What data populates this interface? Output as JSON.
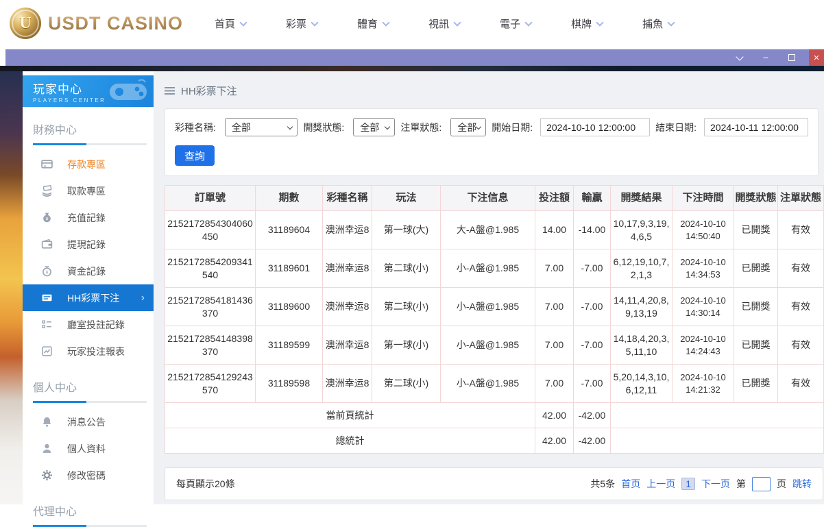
{
  "topnav": {
    "logo": {
      "letter": "U",
      "text": "USDT CASINO"
    },
    "items": [
      {
        "label": "首頁"
      },
      {
        "label": "彩票"
      },
      {
        "label": "體育"
      },
      {
        "label": "視訊"
      },
      {
        "label": "電子"
      },
      {
        "label": "棋牌"
      },
      {
        "label": "捕魚"
      }
    ]
  },
  "sidebar": {
    "title": "玩家中心",
    "subtitle": "PLAYERS CENTER",
    "sections": [
      {
        "title": "財務中心",
        "items": [
          {
            "label": "存款專區",
            "icon": "deposit-card-icon",
            "highlight": "orange"
          },
          {
            "label": "取款專區",
            "icon": "withdraw-hand-icon"
          },
          {
            "label": "充值記錄",
            "icon": "money-bag-icon"
          },
          {
            "label": "提現記錄",
            "icon": "wallet-icon"
          },
          {
            "label": "資金記錄",
            "icon": "coin-purse-icon"
          },
          {
            "label": "HH彩票下注",
            "icon": "bet-card-icon",
            "active": true
          },
          {
            "label": "廳室投註記錄",
            "icon": "list-icon"
          },
          {
            "label": "玩家投注報表",
            "icon": "report-chart-icon"
          }
        ]
      },
      {
        "title": "個人中心",
        "items": [
          {
            "label": "消息公告",
            "icon": "bell-icon"
          },
          {
            "label": "個人資料",
            "icon": "person-icon"
          },
          {
            "label": "修改密碼",
            "icon": "gear-icon"
          }
        ]
      },
      {
        "title": "代理中心",
        "items": []
      }
    ]
  },
  "main": {
    "page_title": "HH彩票下注",
    "filters": {
      "lottery_label": "彩種名稱:",
      "lottery_value": "全部",
      "draw_status_label": "開獎狀態:",
      "draw_status_value": "全部",
      "order_status_label": "注單狀態:",
      "order_status_value": "全部",
      "start_label": "開始日期:",
      "start_value": "2024-10-10 12:00:00",
      "end_label": "結束日期:",
      "end_value": "2024-10-11 12:00:00",
      "search_button": "查詢"
    },
    "table": {
      "headers": [
        "訂單號",
        "期數",
        "彩種名稱",
        "玩法",
        "下注信息",
        "投注額",
        "輸贏",
        "開獎結果",
        "下注時間",
        "開獎狀態",
        "注單狀態"
      ],
      "rows": [
        [
          "2152172854304060450",
          "31189604",
          "澳洲幸运8",
          "第一球(大)",
          "大-A盤@1.985",
          "14.00",
          "-14.00",
          "10,17,9,3,19,4,6,5",
          "2024-10-10 14:50:40",
          "已開獎",
          "有效"
        ],
        [
          "2152172854209341540",
          "31189601",
          "澳洲幸运8",
          "第二球(小)",
          "小-A盤@1.985",
          "7.00",
          "-7.00",
          "6,12,19,10,7,2,1,3",
          "2024-10-10 14:34:53",
          "已開獎",
          "有效"
        ],
        [
          "2152172854181436370",
          "31189600",
          "澳洲幸运8",
          "第二球(小)",
          "小-A盤@1.985",
          "7.00",
          "-7.00",
          "14,11,4,20,8,9,13,19",
          "2024-10-10 14:30:14",
          "已開獎",
          "有效"
        ],
        [
          "2152172854148398370",
          "31189599",
          "澳洲幸运8",
          "第一球(小)",
          "小-A盤@1.985",
          "7.00",
          "-7.00",
          "14,18,4,20,3,5,11,10",
          "2024-10-10 14:24:43",
          "已開獎",
          "有效"
        ],
        [
          "2152172854129243570",
          "31189598",
          "澳洲幸运8",
          "第二球(小)",
          "小-A盤@1.985",
          "7.00",
          "-7.00",
          "5,20,14,3,10,6,12,11",
          "2024-10-10 14:21:32",
          "已開獎",
          "有效"
        ]
      ],
      "summary": [
        {
          "label": "當前頁統計",
          "bet_total": "42.00",
          "win_loss_total": "-42.00"
        },
        {
          "label": "總統計",
          "bet_total": "42.00",
          "win_loss_total": "-42.00"
        }
      ]
    },
    "pagination": {
      "page_size_text": "每頁顯示20條",
      "total_text": "共5条",
      "first": "首页",
      "prev": "上一页",
      "current_page": "1",
      "next": "下一页",
      "jump_label_before": "第",
      "jump_label_after": "页",
      "jump_action": "跳转"
    }
  },
  "colors": {
    "titlebar_purple": "#8588c8",
    "sidebar_active_blue": "#1677d2",
    "accent_orange": "#ef8220",
    "link_blue": "#2b6cd9",
    "button_blue": "#2070e8",
    "table_border_pink": "#f3d6d6",
    "header_gradient_start": "#33a4ef",
    "header_gradient_end": "#1b84dc"
  }
}
